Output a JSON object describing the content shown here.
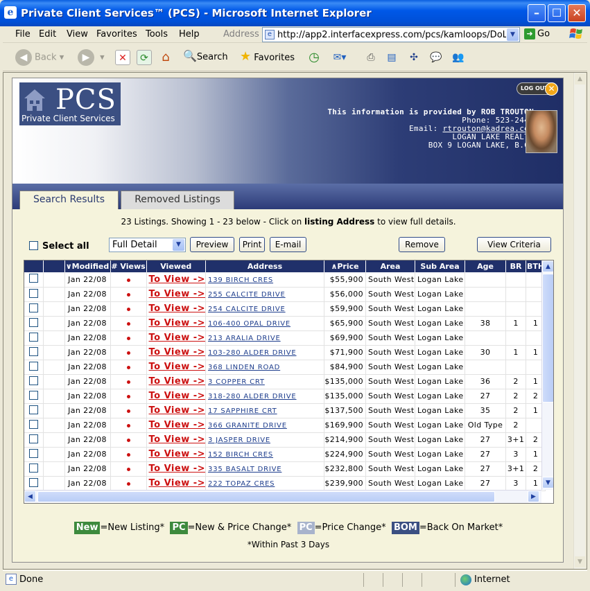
{
  "window": {
    "title": "Private Client Services™ (PCS) - Microsoft Internet Explorer"
  },
  "menu": [
    "File",
    "Edit",
    "View",
    "Favorites",
    "Tools",
    "Help"
  ],
  "address": {
    "label": "Address",
    "url": "http://app2.interfacexpress.com/pcs/kamloops/DoLogin",
    "go": "Go"
  },
  "toolbar": {
    "back": "Back",
    "search": "Search",
    "favorites": "Favorites"
  },
  "header": {
    "logo": "PCS",
    "logo_sub": "Private Client Services",
    "logout": "LOG OUT",
    "agent_lead": "This information is provided by ROB TROUTON",
    "phone": "Phone: 523-2441",
    "email_label": "Email:",
    "email": "rtrouton@kadrea.com",
    "company": "LOGAN LAKE REALTY",
    "address": "BOX 9 LOGAN LAKE, B.C."
  },
  "tabs": [
    "Search Results",
    "Removed Listings"
  ],
  "summary": {
    "pre": "23 Listings. Showing 1 - 23 below - Click on ",
    "bold": "listing Address",
    "post": " to view full details."
  },
  "controls": {
    "select_all": "Select all",
    "detail": "Full Detail",
    "preview": "Preview",
    "print": "Print",
    "email": "E-mail",
    "remove": "Remove",
    "view_criteria": "View Criteria"
  },
  "columns": [
    "",
    "",
    "∨Modified",
    "# Views",
    "Viewed",
    "Address",
    "∧Price",
    "Area",
    "Sub Area",
    "Age",
    "BR",
    "BTH"
  ],
  "rows": [
    {
      "modified": "Jan 22/08",
      "viewed": "To View ->",
      "address": "139 BIRCH CRES",
      "price": "$55,900",
      "area": "South West",
      "subarea": "Logan Lake",
      "age": "",
      "br": "",
      "bth": ""
    },
    {
      "modified": "Jan 22/08",
      "viewed": "To View ->",
      "address": "255 CALCITE DRIVE",
      "price": "$56,000",
      "area": "South West",
      "subarea": "Logan Lake",
      "age": "",
      "br": "",
      "bth": ""
    },
    {
      "modified": "Jan 22/08",
      "viewed": "To View ->",
      "address": "254 CALCITE DRIVE",
      "price": "$59,900",
      "area": "South West",
      "subarea": "Logan Lake",
      "age": "",
      "br": "",
      "bth": ""
    },
    {
      "modified": "Jan 22/08",
      "viewed": "To View ->",
      "address": "106-400 OPAL DRIVE",
      "price": "$65,900",
      "area": "South West",
      "subarea": "Logan Lake",
      "age": "38",
      "br": "1",
      "bth": "1"
    },
    {
      "modified": "Jan 22/08",
      "viewed": "To View ->",
      "address": "213 ARALIA DRIVE",
      "price": "$69,900",
      "area": "South West",
      "subarea": "Logan Lake",
      "age": "",
      "br": "",
      "bth": ""
    },
    {
      "modified": "Jan 22/08",
      "viewed": "To View ->",
      "address": "103-280 ALDER DRIVE",
      "price": "$71,900",
      "area": "South West",
      "subarea": "Logan Lake",
      "age": "30",
      "br": "1",
      "bth": "1"
    },
    {
      "modified": "Jan 22/08",
      "viewed": "To View ->",
      "address": "368 LINDEN ROAD",
      "price": "$84,900",
      "area": "South West",
      "subarea": "Logan Lake",
      "age": "",
      "br": "",
      "bth": ""
    },
    {
      "modified": "Jan 22/08",
      "viewed": "To View ->",
      "address": "3 COPPER CRT",
      "price": "$135,000",
      "area": "South West",
      "subarea": "Logan Lake",
      "age": "36",
      "br": "2",
      "bth": "1"
    },
    {
      "modified": "Jan 22/08",
      "viewed": "To View ->",
      "address": "318-280 ALDER DRIVE",
      "price": "$135,000",
      "area": "South West",
      "subarea": "Logan Lake",
      "age": "27",
      "br": "2",
      "bth": "2"
    },
    {
      "modified": "Jan 22/08",
      "viewed": "To View ->",
      "address": "17 SAPPHIRE CRT",
      "price": "$137,500",
      "area": "South West",
      "subarea": "Logan Lake",
      "age": "35",
      "br": "2",
      "bth": "1"
    },
    {
      "modified": "Jan 22/08",
      "viewed": "To View ->",
      "address": "366 GRANITE DRIVE",
      "price": "$169,900",
      "area": "South West",
      "subarea": "Logan Lake",
      "age": "Old Type",
      "br": "2",
      "bth": ""
    },
    {
      "modified": "Jan 22/08",
      "viewed": "To View ->",
      "address": "3 JASPER DRIVE",
      "price": "$214,900",
      "area": "South West",
      "subarea": "Logan Lake",
      "age": "27",
      "br": "3+1",
      "bth": "2"
    },
    {
      "modified": "Jan 22/08",
      "viewed": "To View ->",
      "address": "152 BIRCH CRES",
      "price": "$224,900",
      "area": "South West",
      "subarea": "Logan Lake",
      "age": "27",
      "br": "3",
      "bth": "1"
    },
    {
      "modified": "Jan 22/08",
      "viewed": "To View ->",
      "address": "335 BASALT DRIVE",
      "price": "$232,800",
      "area": "South West",
      "subarea": "Logan Lake",
      "age": "27",
      "br": "3+1",
      "bth": "2"
    },
    {
      "modified": "Jan 22/08",
      "viewed": "To View ->",
      "address": "222 TOPAZ CRES",
      "price": "$239,900",
      "area": "South West",
      "subarea": "Logan Lake",
      "age": "27",
      "br": "3",
      "bth": "1"
    }
  ],
  "legend": {
    "new": "New",
    "new_text": "=New Listing*",
    "pc": "PC",
    "pc_text": "=New & Price Change*",
    "pc2": "PC",
    "pc2_text": "=Price Change*",
    "bom": "BOM",
    "bom_text": "=Back On Market*",
    "foot": "*Within Past 3 Days"
  },
  "colors": {
    "new": "#3d8a3d",
    "pc": "#3d8a3d",
    "pc2": "#a8b3cc",
    "bom": "#3b4f82"
  },
  "status": {
    "done": "Done",
    "zone": "Internet"
  }
}
